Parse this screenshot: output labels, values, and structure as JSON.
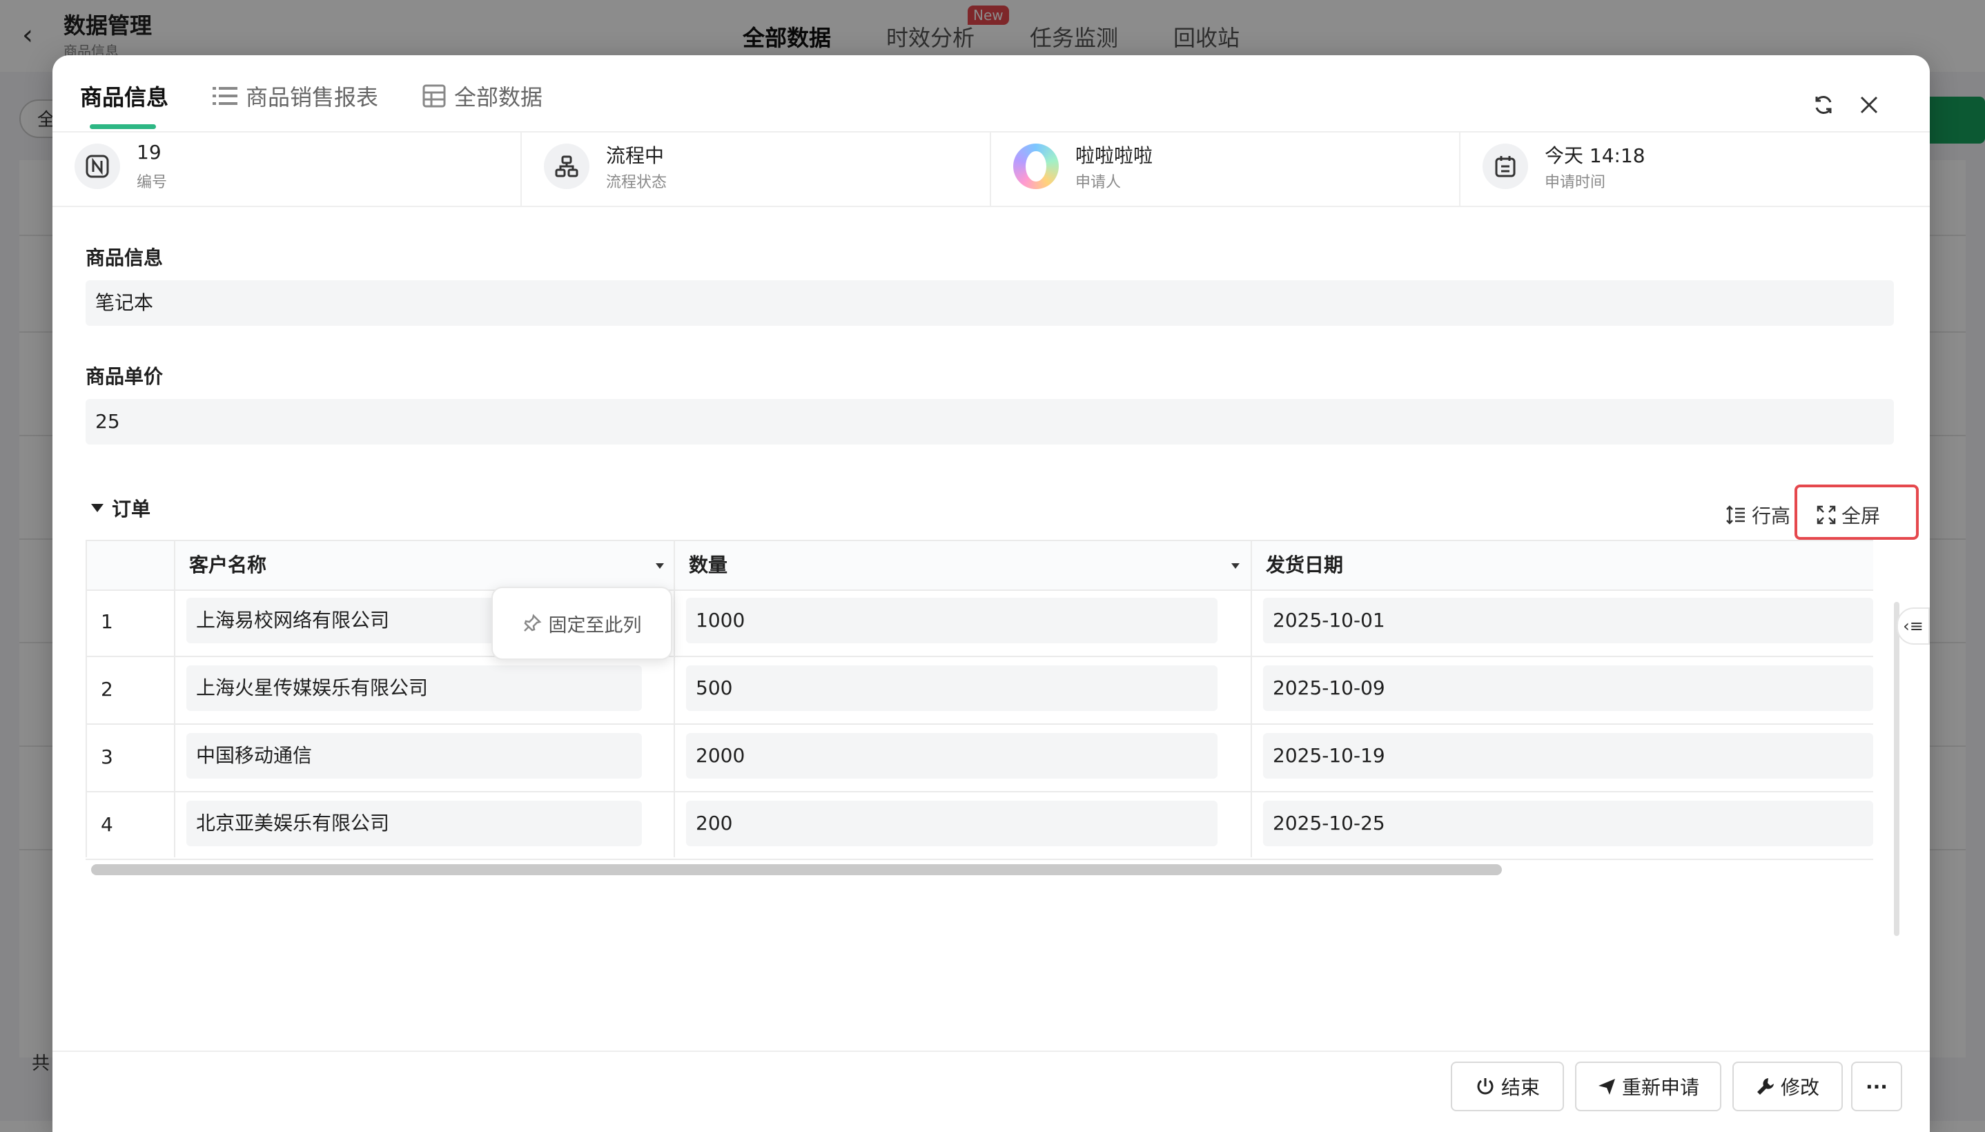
{
  "background": {
    "title": "数据管理",
    "subtitle": "商品信息",
    "tabs": [
      "全部数据",
      "时效分析",
      "任务监测",
      "回收站"
    ],
    "new_badge": "New",
    "search_prefix": "全",
    "total_prefix": "共"
  },
  "modal": {
    "tabs": [
      {
        "label": "商品信息",
        "icon": "none"
      },
      {
        "label": "商品销售报表",
        "icon": "list-icon"
      },
      {
        "label": "全部数据",
        "icon": "table-icon"
      }
    ],
    "info": [
      {
        "value": "19",
        "label": "编号",
        "icon": "number-icon"
      },
      {
        "value": "流程中",
        "label": "流程状态",
        "icon": "flow-icon"
      },
      {
        "value": "啦啦啦啦",
        "label": "申请人",
        "icon": "avatar"
      },
      {
        "value": "今天 14:18",
        "label": "申请时间",
        "icon": "calendar-icon"
      }
    ],
    "fields": [
      {
        "label": "商品信息",
        "value": "笔记本"
      },
      {
        "label": "商品单价",
        "value": "25"
      }
    ],
    "order": {
      "title": "订单",
      "row_height_label": "行高",
      "fullscreen_label": "全屏",
      "columns": [
        "客户名称",
        "数量",
        "发货日期"
      ],
      "rows": [
        {
          "index": "1",
          "customer": "上海易校网络有限公司",
          "qty": "1000",
          "date": "2025-10-01"
        },
        {
          "index": "2",
          "customer": "上海火星传媒娱乐有限公司",
          "qty": "500",
          "date": "2025-10-09"
        },
        {
          "index": "3",
          "customer": "中国移动通信",
          "qty": "2000",
          "date": "2025-10-19"
        },
        {
          "index": "4",
          "customer": "北京亚美娱乐有限公司",
          "qty": "200",
          "date": "2025-10-25"
        }
      ],
      "pin_popup": "固定至此列"
    },
    "footer": {
      "end_label": "结束",
      "reapply_label": "重新申请",
      "edit_label": "修改",
      "more_label": "···"
    }
  },
  "colors": {
    "accent": "#2db784",
    "highlight": "#e5484d",
    "badge": "#e5484d"
  }
}
